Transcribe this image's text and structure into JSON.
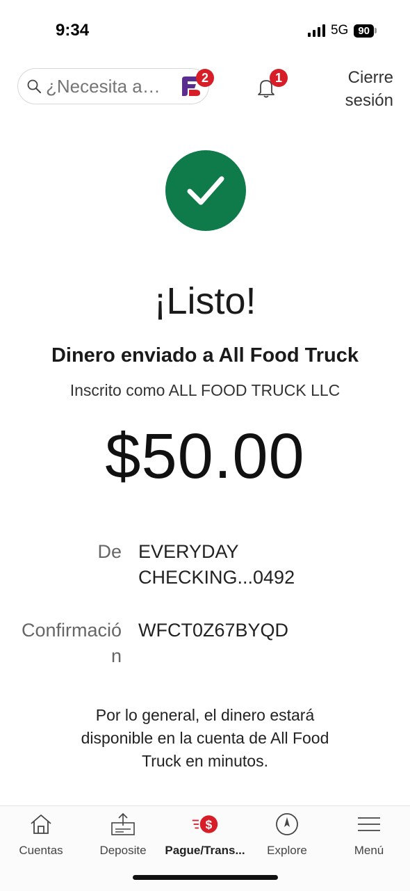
{
  "status_bar": {
    "time": "9:34",
    "network": "5G",
    "battery": "90"
  },
  "header": {
    "search_placeholder": "¿Necesita a…",
    "fargo_badge": "2",
    "bell_badge": "1",
    "signout_line1": "Cierre",
    "signout_line2": "sesión"
  },
  "result": {
    "title": "¡Listo!",
    "headline": "Dinero enviado a All Food Truck",
    "subtext": "Inscrito como ALL FOOD TRUCK LLC",
    "amount": "$50.00"
  },
  "details": {
    "from_label": "De",
    "from_value_line1": "EVERYDAY",
    "from_value_line2": "CHECKING...0492",
    "confirmation_label": "Confirmación",
    "confirmation_value": "WFCT0Z67BYQD"
  },
  "note": "Por lo general, el dinero estará disponible en la cuenta de All Food Truck en minutos.",
  "nav": {
    "items": [
      {
        "label": "Cuentas",
        "icon": "home-icon",
        "active": false
      },
      {
        "label": "Deposite",
        "icon": "deposit-icon",
        "active": false
      },
      {
        "label": "Pague/Trans...",
        "icon": "pay-transfer-icon",
        "active": true
      },
      {
        "label": "Explore",
        "icon": "compass-icon",
        "active": false
      },
      {
        "label": "Menú",
        "icon": "menu-icon",
        "active": false
      }
    ]
  },
  "colors": {
    "success_green": "#0f7a4a",
    "brand_red": "#d71e28",
    "fargo_purple": "#5b2d8e"
  }
}
